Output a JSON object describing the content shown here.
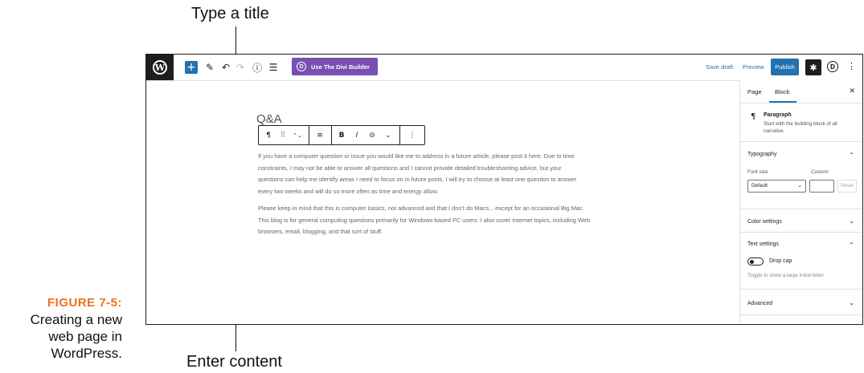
{
  "callouts": {
    "top": "Type a title",
    "bottom": "Enter content"
  },
  "figure": {
    "label": "FIGURE 7-5:",
    "caption_line1": "Creating a new",
    "caption_line2": "web page in",
    "caption_line3": "WordPress."
  },
  "toolbar": {
    "logo_glyph": "W",
    "add_glyph": "+",
    "edit_glyph": "✎",
    "undo_glyph": "↶",
    "redo_glyph": "↷",
    "info_glyph": "ⓘ",
    "outline_glyph": "☰",
    "divi_glyph": "D",
    "divi_label": "Use The Divi Builder",
    "save_draft": "Save draft",
    "preview": "Preview",
    "publish": "Publish",
    "settings_glyph": "✱",
    "d_glyph": "D",
    "more_glyph": "⋮"
  },
  "editor": {
    "title": "Q&A",
    "block_toolbar": {
      "paragraph": "¶",
      "drag": "⠿",
      "move": "⌃⌄",
      "align": "≡",
      "bold": "B",
      "italic": "I",
      "link": "⊝",
      "more_rich": "⌄",
      "options": "⋮"
    },
    "para1_lines": [
      "If you have a computer question or issue you would like me to address in a future article, please post it here. Due to time",
      "constraints, I may not be able to answer all questions and I cannot provide detailed troubleshooting advice, but your",
      "questions can help me identify areas I need to focus on in future posts. I will try to choose at least one question to answer",
      "every two weeks and will do so more often as time and energy allow."
    ],
    "para2_line1_before": "Please keep in mind that this is computer ",
    "para2_line1_italic": "basics",
    "para2_line1_after": ", not advanced and that I don't do Macs... except for an occasional Big Mac.",
    "para2_line2": "This blog is for general computing questions primarily for Windows-based PC users. I also cover Internet topics, including Web",
    "para2_line3": "browsers, email, blogging, and that sort of stuff."
  },
  "sidebar": {
    "tab_page": "Page",
    "tab_block": "Block",
    "close_glyph": "✕",
    "block_icon": "¶",
    "block_name": "Paragraph",
    "block_desc_line1": "Start with the building block of all",
    "block_desc_line2": "narrative.",
    "typography": "Typography",
    "font_size_label": "Font size",
    "custom_label": "Custom",
    "font_size_value": "Default",
    "reset": "Reset",
    "color_settings": "Color settings",
    "text_settings": "Text settings",
    "drop_cap": "Drop cap",
    "drop_cap_help": "Toggle to show a large initial letter.",
    "advanced": "Advanced",
    "chev_up": "⌃",
    "chev_down": "⌄"
  }
}
